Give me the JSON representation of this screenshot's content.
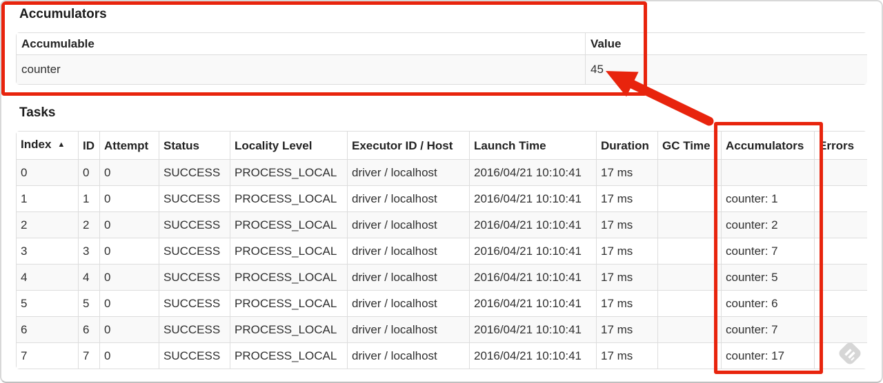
{
  "annotations": {
    "color": "#e8240d",
    "highlighted_value": "45",
    "highlighted_column": "Accumulators"
  },
  "accumulators_section": {
    "title": "Accumulators",
    "table": {
      "headers": [
        "Accumulable",
        "Value"
      ],
      "rows": [
        [
          "counter",
          "45"
        ]
      ]
    }
  },
  "tasks_section": {
    "title": "Tasks",
    "table": {
      "headers": [
        "Index",
        "ID",
        "Attempt",
        "Status",
        "Locality Level",
        "Executor ID / Host",
        "Launch Time",
        "Duration",
        "GC Time",
        "Accumulators",
        "Errors"
      ],
      "sort_indicator": "▲",
      "sorted_column": "Index",
      "rows": [
        [
          "0",
          "0",
          "0",
          "SUCCESS",
          "PROCESS_LOCAL",
          "driver / localhost",
          "2016/04/21 10:10:41",
          "17 ms",
          "",
          "",
          ""
        ],
        [
          "1",
          "1",
          "0",
          "SUCCESS",
          "PROCESS_LOCAL",
          "driver / localhost",
          "2016/04/21 10:10:41",
          "17 ms",
          "",
          "counter: 1",
          ""
        ],
        [
          "2",
          "2",
          "0",
          "SUCCESS",
          "PROCESS_LOCAL",
          "driver / localhost",
          "2016/04/21 10:10:41",
          "17 ms",
          "",
          "counter: 2",
          ""
        ],
        [
          "3",
          "3",
          "0",
          "SUCCESS",
          "PROCESS_LOCAL",
          "driver / localhost",
          "2016/04/21 10:10:41",
          "17 ms",
          "",
          "counter: 7",
          ""
        ],
        [
          "4",
          "4",
          "0",
          "SUCCESS",
          "PROCESS_LOCAL",
          "driver / localhost",
          "2016/04/21 10:10:41",
          "17 ms",
          "",
          "counter: 5",
          ""
        ],
        [
          "5",
          "5",
          "0",
          "SUCCESS",
          "PROCESS_LOCAL",
          "driver / localhost",
          "2016/04/21 10:10:41",
          "17 ms",
          "",
          "counter: 6",
          ""
        ],
        [
          "6",
          "6",
          "0",
          "SUCCESS",
          "PROCESS_LOCAL",
          "driver / localhost",
          "2016/04/21 10:10:41",
          "17 ms",
          "",
          "counter: 7",
          ""
        ],
        [
          "7",
          "7",
          "0",
          "SUCCESS",
          "PROCESS_LOCAL",
          "driver / localhost",
          "2016/04/21 10:10:41",
          "17 ms",
          "",
          "counter: 17",
          ""
        ]
      ]
    }
  }
}
